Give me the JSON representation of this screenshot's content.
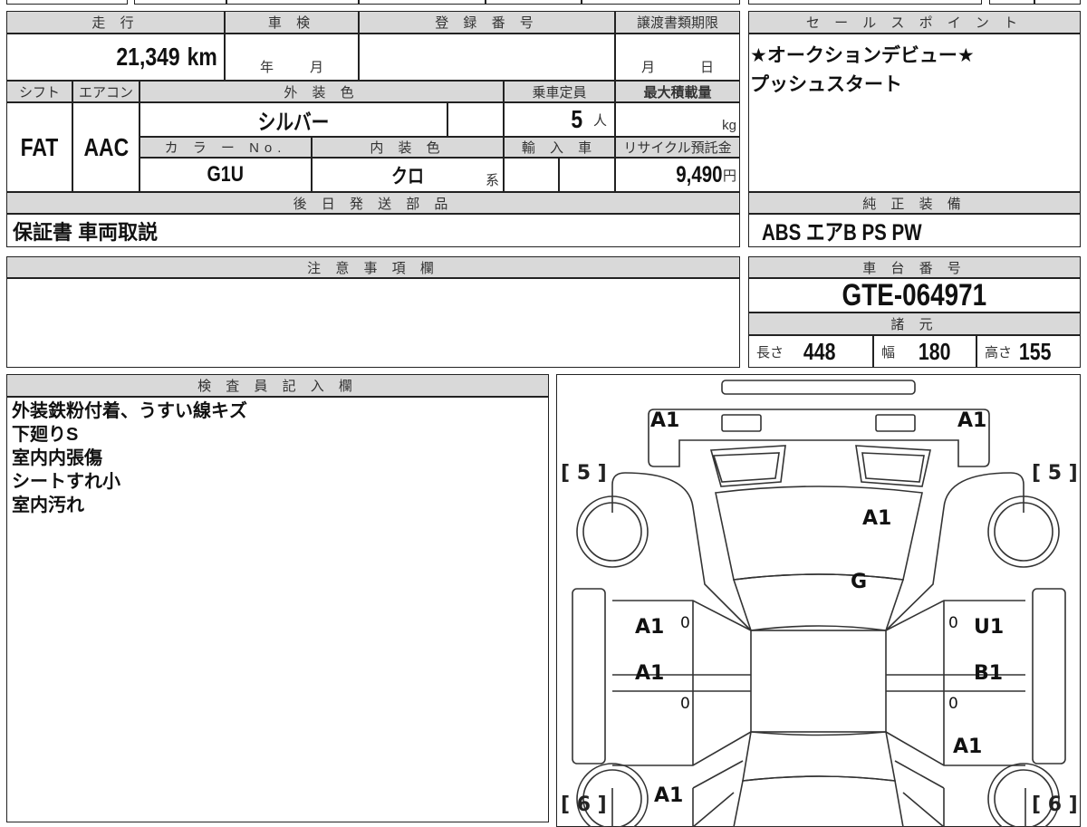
{
  "main": {
    "mileage": {
      "label": "走 行",
      "value": "21,349",
      "unit": "km"
    },
    "inspection": {
      "label": "車 検",
      "year": "年",
      "month": "月"
    },
    "registration": {
      "label": "登 録 番 号",
      "value": ""
    },
    "transfer_deadline": {
      "label": "譲渡書類期限",
      "month": "月",
      "day": "日"
    },
    "shift": {
      "label": "シフト",
      "value": "FAT"
    },
    "aircon": {
      "label": "エアコン",
      "value": "AAC"
    },
    "exterior_color": {
      "label": "外 装 色",
      "value": "シルバー"
    },
    "capacity": {
      "label": "乗車定員",
      "value": "5",
      "unit": "人"
    },
    "max_load": {
      "label": "最大積載量",
      "unit": "kg"
    },
    "color_no": {
      "label": "カ ラ ー No.",
      "value": "G1U"
    },
    "interior_color": {
      "label": "内 装 色",
      "value": "クロ",
      "suffix": "系"
    },
    "import": {
      "label": "輸 入 車"
    },
    "recycle": {
      "label": "リサイクル預託金",
      "value": "9,490",
      "unit": "円"
    },
    "later_parts": {
      "label": "後 日 発 送 部 品",
      "value": "保証書 車両取説"
    }
  },
  "sales_point": {
    "label": "セ ー ル ス ポ イ ン ト",
    "lines": [
      "★オークションデビュー★",
      "プッシュスタート"
    ]
  },
  "equipment": {
    "label": "純 正 装 備",
    "value": "ABS エアB PS PW"
  },
  "chassis": {
    "label": "車 台 番 号",
    "value": "GTE-064971"
  },
  "specs": {
    "label": "諸 元",
    "length_label": "長さ",
    "length": "448",
    "width_label": "幅",
    "width": "180",
    "height_label": "高さ",
    "height": "155"
  },
  "notes": {
    "label": "注 意 事 項 欄",
    "value": ""
  },
  "inspector": {
    "label": "検 査 員 記 入 欄",
    "lines": [
      "外装鉄粉付着、うすい線キズ",
      "下廻りS",
      "室内内張傷",
      "シートすれ小",
      "室内汚れ"
    ]
  },
  "diagram": {
    "front_left": "A1",
    "front_right": "A1",
    "tire_fl": "[ 5 ]",
    "tire_fr": "[ 5 ]",
    "hood": "A1",
    "windshield": "G",
    "left_front_door": "A1",
    "left_rear_door": "A1",
    "right_front_door": "U1",
    "right_rear_door": "B1",
    "zeros": [
      "0",
      "0",
      "0",
      "0"
    ],
    "right_rear_fender": "A1",
    "left_rear_fender": "A1",
    "tire_rl": "[ 6 ]",
    "tire_rr": "[ 6 ]"
  }
}
